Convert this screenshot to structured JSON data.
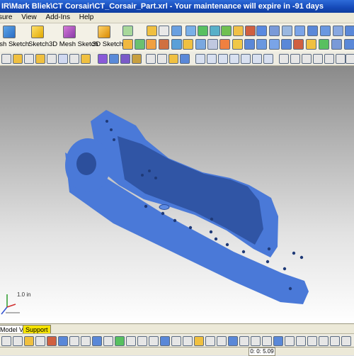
{
  "title": "IR\\Mark Bliek\\CT Corsair\\CT_Corsair_Part.xrl - Your maintenance will expire in -91 days",
  "menu": [
    "sure",
    "View",
    "Add-Ins",
    "Help"
  ],
  "ribbon": {
    "labels": [
      "esh Sketch",
      "Sketch",
      "3D Mesh Sketch",
      "3D Sketch"
    ]
  },
  "viewport": {
    "scale_label": "1.0 in",
    "part_color": "#4a79d8",
    "part_shadow": "#2c4f9c"
  },
  "tabs": {
    "model_view": "Model View",
    "support": "Support"
  },
  "status": {
    "time": "0: 0: 5.09"
  }
}
